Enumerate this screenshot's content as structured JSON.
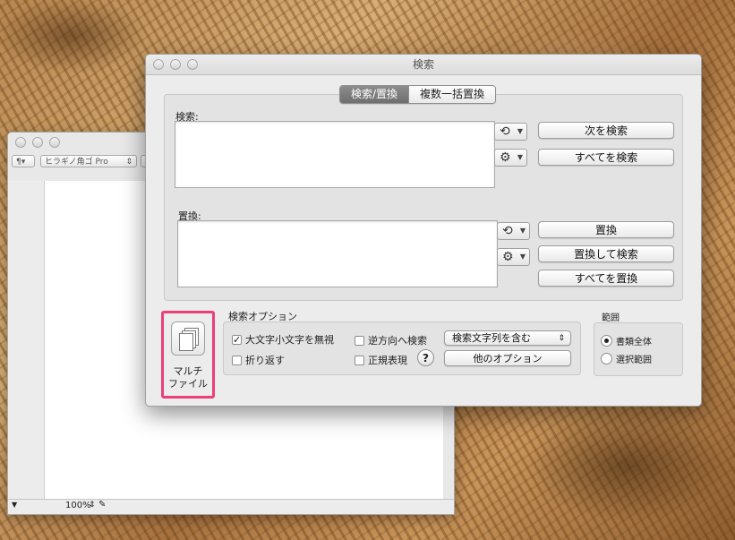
{
  "back_window": {
    "toolbar": {
      "paragraph": "¶▾",
      "font": "ヒラギノ角ゴ Pro",
      "font_arrow": "⇕"
    },
    "status": {
      "zoom": "100%",
      "zoom_arrow": "⇕",
      "left_arrow": "▼"
    }
  },
  "find_window": {
    "title": "検索",
    "tabs": [
      {
        "label": "検索/置換"
      },
      {
        "label": "複数一括置換"
      }
    ],
    "search": {
      "label": "検索:",
      "value": ""
    },
    "replace": {
      "label": "置換:",
      "value": ""
    },
    "buttons": {
      "find_next": "次を検索",
      "find_all": "すべてを検索",
      "replace": "置換",
      "replace_and_find": "置換して検索",
      "replace_all": "すべてを置換"
    },
    "options": {
      "title": "検索オプション",
      "ignore_case": {
        "label": "大文字小文字を無視",
        "checked": true
      },
      "wrap": {
        "label": "折り返す",
        "checked": false
      },
      "backwards": {
        "label": "逆方向へ検索",
        "checked": false
      },
      "regex": {
        "label": "正規表現",
        "checked": false
      },
      "match_popup": "検索文字列を含む",
      "match_popup_arrow": "⇕",
      "other_options": "他のオプション",
      "help": "?"
    },
    "scope": {
      "title": "範囲",
      "whole_document": {
        "label": "書類全体",
        "selected": true
      },
      "selection": {
        "label": "選択範囲",
        "selected": false
      }
    },
    "multi_file": {
      "line1": "マルチ",
      "line2": "ファイル"
    }
  }
}
